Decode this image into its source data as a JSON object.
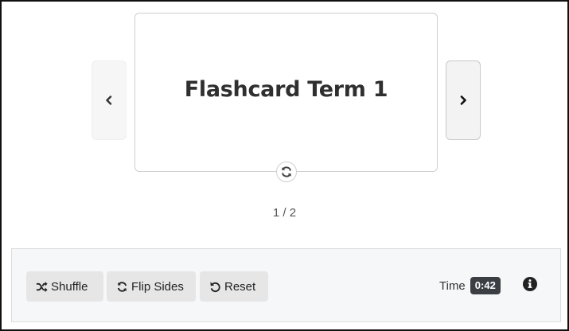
{
  "card": {
    "term": "Flashcard Term 1",
    "flip_icon": "rotate-icon"
  },
  "nav": {
    "prev_icon": "chevron-left-icon",
    "next_icon": "chevron-right-icon"
  },
  "counter": {
    "text": "1 / 2"
  },
  "toolbar": {
    "shuffle_label": "Shuffle",
    "shuffle_icon": "shuffle-icon",
    "flip_label": "Flip Sides",
    "flip_icon": "rotate-icon",
    "reset_label": "Reset",
    "reset_icon": "undo-icon",
    "time_label": "Time",
    "time_value": "0:42",
    "info_icon": "info-circle-icon"
  },
  "colors": {
    "badge_bg": "#3b3f44",
    "toolbar_bg": "#f6f7f8",
    "button_bg": "#e6e6e6",
    "text_dark": "#2f2f2f"
  }
}
